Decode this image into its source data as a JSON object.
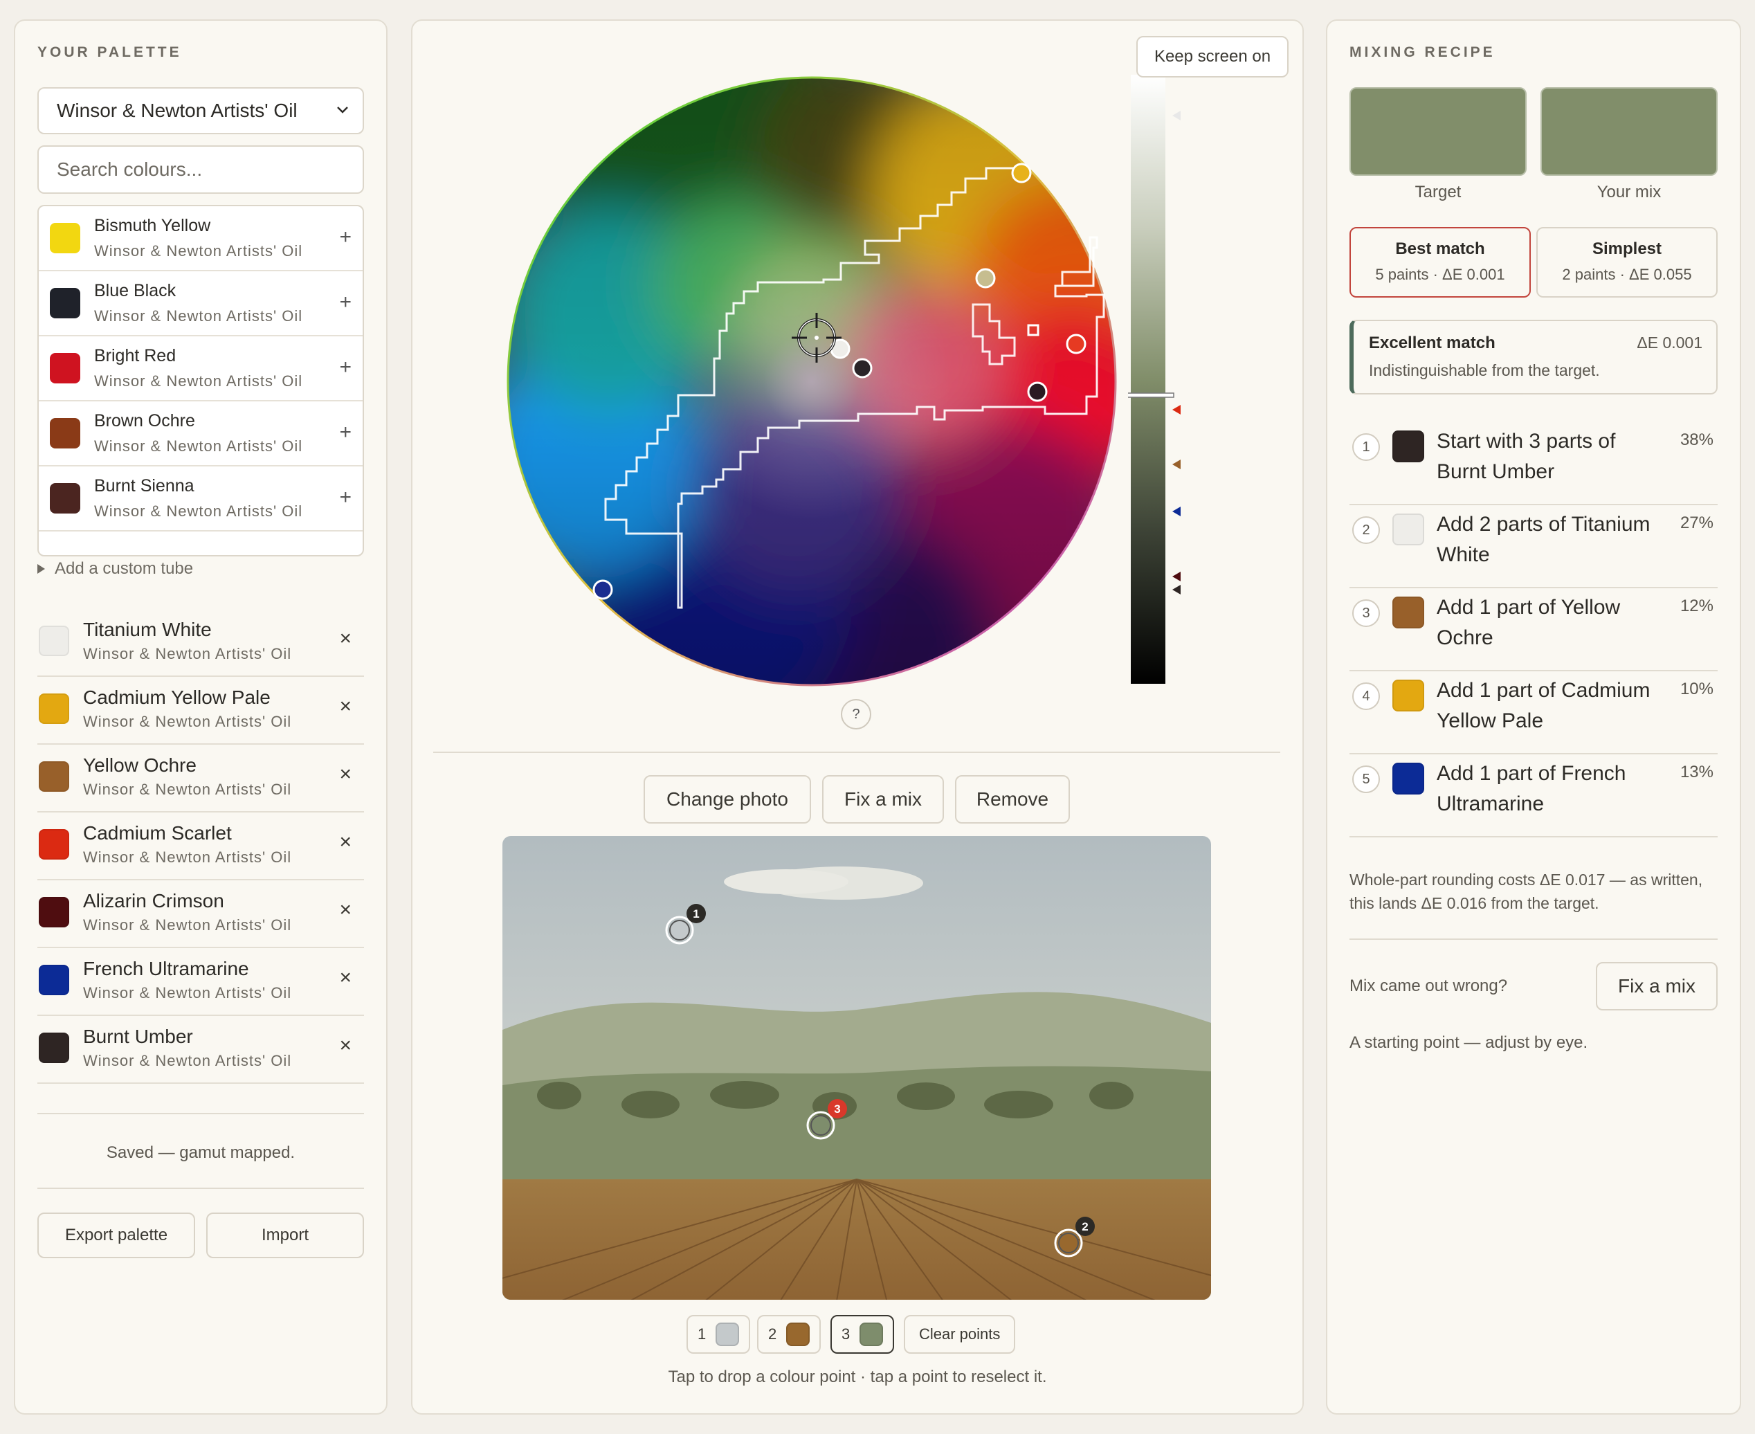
{
  "palette": {
    "title": "YOUR PALETTE",
    "brand_select": "Winsor & Newton Artists' Oil",
    "search_placeholder": "Search colours...",
    "catalog": [
      {
        "name": "Bismuth Yellow",
        "brand": "Winsor & Newton Artists' Oil",
        "color": "#f2d711",
        "action": "+"
      },
      {
        "name": "Blue Black",
        "brand": "Winsor & Newton Artists' Oil",
        "color": "#1f222a",
        "action": "+"
      },
      {
        "name": "Bright Red",
        "brand": "Winsor & Newton Artists' Oil",
        "color": "#cf1320",
        "action": "+"
      },
      {
        "name": "Brown Ochre",
        "brand": "Winsor & Newton Artists' Oil",
        "color": "#8a3a17",
        "action": "+"
      },
      {
        "name": "Burnt Sienna",
        "brand": "Winsor & Newton Artists' Oil",
        "color": "#4b2520",
        "action": "+"
      }
    ],
    "add_custom": "Add a custom tube",
    "selected": [
      {
        "name": "Titanium White",
        "brand": "Winsor & Newton Artists' Oil",
        "color": "#eeede9",
        "action": "×"
      },
      {
        "name": "Cadmium Yellow Pale",
        "brand": "Winsor & Newton Artists' Oil",
        "color": "#e3a811",
        "action": "×"
      },
      {
        "name": "Yellow Ochre",
        "brand": "Winsor & Newton Artists' Oil",
        "color": "#98602a",
        "action": "×"
      },
      {
        "name": "Cadmium Scarlet",
        "brand": "Winsor & Newton Artists' Oil",
        "color": "#db2a12",
        "action": "×"
      },
      {
        "name": "Alizarin Crimson",
        "brand": "Winsor & Newton Artists' Oil",
        "color": "#4f0d10",
        "action": "×"
      },
      {
        "name": "French Ultramarine",
        "brand": "Winsor & Newton Artists' Oil",
        "color": "#0c2b96",
        "action": "×"
      },
      {
        "name": "Burnt Umber",
        "brand": "Winsor & Newton Artists' Oil",
        "color": "#2e2523",
        "action": "×"
      }
    ],
    "status": "Saved — gamut mapped.",
    "export_label": "Export palette",
    "import_label": "Import"
  },
  "center": {
    "keep_screen_on": "Keep screen on",
    "help": "?",
    "photo_buttons": {
      "change": "Change photo",
      "fix": "Fix a mix",
      "remove": "Remove"
    },
    "photo_points": [
      {
        "num": "1",
        "color": "#c4c9cb"
      },
      {
        "num": "2",
        "color": "#98682e"
      },
      {
        "num": "3",
        "color": "#7e8d6c"
      }
    ],
    "selected_point": "3",
    "clear_points": "Clear points",
    "hint": "Tap to drop a colour point · tap a point to reselect it."
  },
  "recipe": {
    "title": "MIXING RECIPE",
    "target_label": "Target",
    "mix_label": "Your mix",
    "target_color": "#818e6a",
    "mix_color": "#818e6a",
    "modes": [
      {
        "title": "Best match",
        "sub": "5 paints · ΔE 0.001",
        "selected": true
      },
      {
        "title": "Simplest",
        "sub": "2 paints · ΔE 0.055",
        "selected": false
      }
    ],
    "quality": {
      "title": "Excellent match",
      "delta": "ΔE 0.001",
      "desc": "Indistinguishable from the target."
    },
    "steps": [
      {
        "num": "1",
        "text": "Start with 3 parts of Burnt Umber",
        "pct": "38%",
        "color": "#2e2523"
      },
      {
        "num": "2",
        "text": "Add 2 parts of Titanium White",
        "pct": "27%",
        "color": "#eeede9"
      },
      {
        "num": "3",
        "text": "Add 1 part of Yellow Ochre",
        "pct": "12%",
        "color": "#98602a"
      },
      {
        "num": "4",
        "text": "Add 1 part of Cadmium Yellow Pale",
        "pct": "10%",
        "color": "#e3a811"
      },
      {
        "num": "5",
        "text": "Add 1 part of French Ultramarine",
        "pct": "13%",
        "color": "#0c2b96"
      }
    ],
    "rounding_note": "Whole-part rounding costs ΔE 0.017 — as written, this lands ΔE 0.016 from the target.",
    "wrong_label": "Mix came out wrong?",
    "fix_label": "Fix a mix",
    "footnote": "A starting point — adjust by eye."
  }
}
